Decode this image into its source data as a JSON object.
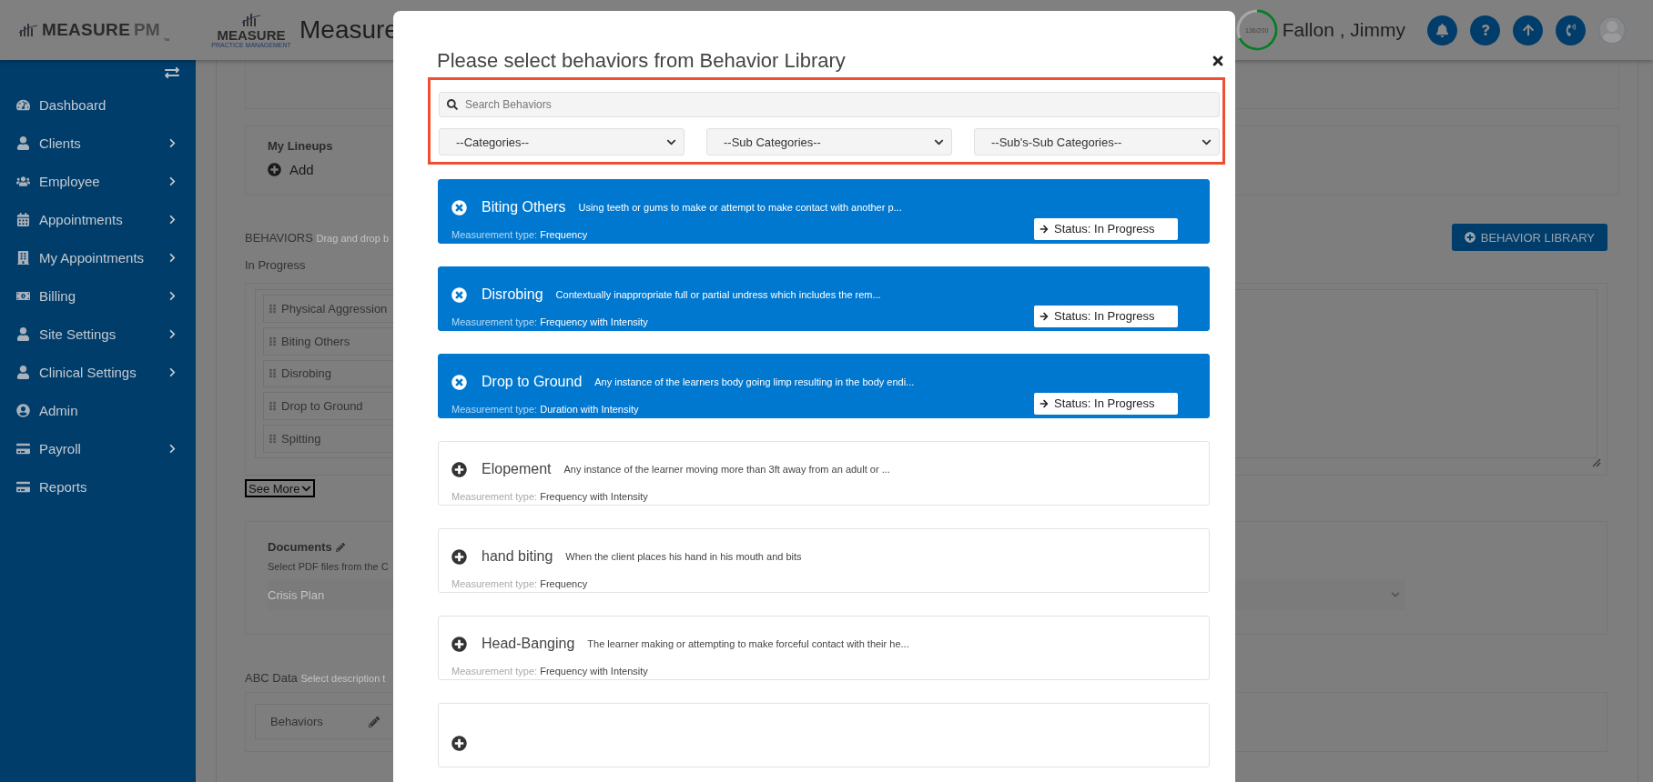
{
  "sidebar_logo": {
    "name": "MEASURE",
    "suffix": "PM",
    "mark": "™"
  },
  "header": {
    "logo": {
      "name": "MEASURE",
      "tagline": "PRACTICE MANAGEMENT"
    },
    "title": "Measure",
    "usage": {
      "reading": "136/200"
    },
    "user": "Fallon , Jimmy"
  },
  "sidebar": {
    "items": [
      {
        "label": "Dashboard",
        "submenu": false
      },
      {
        "label": "Clients",
        "submenu": true
      },
      {
        "label": "Employee",
        "submenu": true
      },
      {
        "label": "Appointments",
        "submenu": true
      },
      {
        "label": "My Appointments",
        "submenu": true
      },
      {
        "label": "Billing",
        "submenu": true
      },
      {
        "label": "Site Settings",
        "submenu": true
      },
      {
        "label": "Clinical Settings",
        "submenu": true
      },
      {
        "label": "Admin",
        "submenu": false
      },
      {
        "label": "Payroll",
        "submenu": true
      },
      {
        "label": "Reports",
        "submenu": false
      }
    ]
  },
  "page": {
    "lineups": {
      "title": "My Lineups",
      "add": "Add"
    },
    "behaviors": {
      "label": "BEHAVIORS",
      "hint": "Drag and drop b",
      "group": "In Progress",
      "items": [
        "Physical Aggression",
        "Biting Others",
        "Disrobing",
        "Drop to Ground",
        "Spitting"
      ],
      "see_more": "See More",
      "library_button": "BEHAVIOR LIBRARY"
    },
    "documents": {
      "title": "Documents",
      "hint": "Select PDF files from the C",
      "select": "Crisis Plan"
    },
    "abc": {
      "label": "ABC Data",
      "hint": "Select description t",
      "row": "Behaviors"
    }
  },
  "modal": {
    "title": "Please select behaviors from Behavior Library",
    "search": {
      "placeholder": "Search Behaviors"
    },
    "filters": [
      "--Categories--",
      "--Sub Categories--",
      "--Sub's-Sub Categories--"
    ],
    "cards": [
      {
        "title": "Biting Others",
        "description": "Using teeth or gums to make or attempt to make contact with another p...",
        "measurement_label": "Measurement type:",
        "measurement": "Frequency",
        "selected": true,
        "status": "Status: In Progress"
      },
      {
        "title": "Disrobing",
        "description": "Contextually inappropriate full or partial undress which includes the rem...",
        "measurement_label": "Measurement type:",
        "measurement": "Frequency with Intensity",
        "selected": true,
        "status": "Status: In Progress"
      },
      {
        "title": "Drop to Ground",
        "description": "Any instance of the learners body going limp resulting in the body endi...",
        "measurement_label": "Measurement type:",
        "measurement": "Duration with Intensity",
        "selected": true,
        "status": "Status: In Progress"
      },
      {
        "title": "Elopement",
        "description": "Any instance of the learner moving more than 3ft away from an adult or ...",
        "measurement_label": "Measurement type:",
        "measurement": "Frequency with Intensity",
        "selected": false
      },
      {
        "title": "hand biting",
        "description": "When the client places his hand in his mouth and bits",
        "measurement_label": "Measurement type:",
        "measurement": "Frequency",
        "selected": false
      },
      {
        "title": "Head-Banging",
        "description": "The learner making or attempting to make forceful contact with their he...",
        "measurement_label": "Measurement type:",
        "measurement": "Frequency with Intensity",
        "selected": false
      },
      {
        "selected": false
      }
    ]
  }
}
